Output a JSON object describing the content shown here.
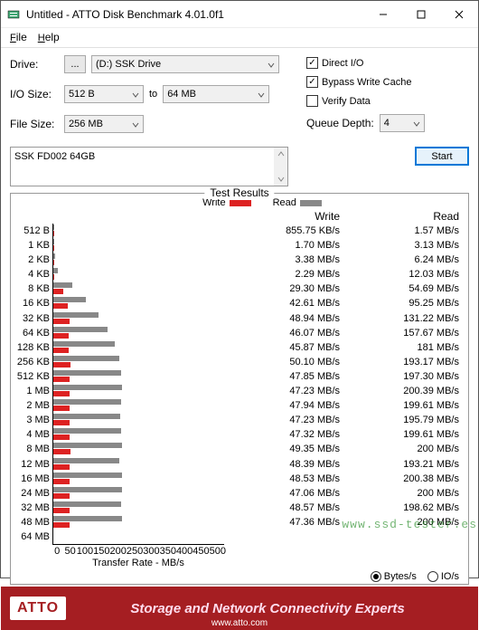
{
  "window": {
    "title": "Untitled - ATTO Disk Benchmark 4.01.0f1"
  },
  "menu": {
    "file": "File",
    "help": "Help"
  },
  "labels": {
    "drive": "Drive:",
    "iosize": "I/O Size:",
    "filesize": "File Size:",
    "to": "to",
    "direct_io": "Direct I/O",
    "bypass": "Bypass Write Cache",
    "verify": "Verify Data",
    "queue": "Queue Depth:",
    "start": "Start",
    "results": "Test Results",
    "write": "Write",
    "read": "Read",
    "xlabel": "Transfer Rate - MB/s",
    "bytes_s": "Bytes/s",
    "io_s": "IO/s",
    "brand": "ATTO",
    "tagline": "Storage and Network Connectivity Experts",
    "site": "www.atto.com"
  },
  "fields": {
    "drive": "(D:) SSK Drive",
    "io_from": "512 B",
    "io_to": "64 MB",
    "filesize": "256 MB",
    "queue": "4",
    "desc": "SSK FD002 64GB"
  },
  "watermark": "www.ssd-tester.es",
  "xticks": [
    "0",
    "50",
    "100",
    "150",
    "200",
    "250",
    "300",
    "350",
    "400",
    "450",
    "500"
  ],
  "chart_data": {
    "type": "bar",
    "xlabel": "Transfer Rate - MB/s",
    "xlim": [
      0,
      500
    ],
    "categories": [
      "512 B",
      "1 KB",
      "2 KB",
      "4 KB",
      "8 KB",
      "16 KB",
      "32 KB",
      "64 KB",
      "128 KB",
      "256 KB",
      "512 KB",
      "1 MB",
      "2 MB",
      "3 MB",
      "4 MB",
      "8 MB",
      "12 MB",
      "16 MB",
      "24 MB",
      "32 MB",
      "48 MB",
      "64 MB"
    ],
    "series": [
      {
        "name": "Write",
        "color": "#d22",
        "values_label": [
          "855.75 KB/s",
          "1.70 MB/s",
          "3.38 MB/s",
          "2.29 MB/s",
          "29.30 MB/s",
          "42.61 MB/s",
          "48.94 MB/s",
          "46.07 MB/s",
          "45.87 MB/s",
          "50.10 MB/s",
          "47.85 MB/s",
          "47.23 MB/s",
          "47.94 MB/s",
          "47.23 MB/s",
          "47.32 MB/s",
          "49.35 MB/s",
          "48.39 MB/s",
          "48.53 MB/s",
          "47.06 MB/s",
          "48.57 MB/s",
          "47.36 MB/s"
        ],
        "values_mb": [
          0.836,
          1.7,
          3.38,
          2.29,
          29.3,
          42.61,
          48.94,
          46.07,
          45.87,
          50.1,
          47.85,
          47.23,
          47.94,
          47.23,
          47.32,
          49.35,
          48.39,
          48.53,
          47.06,
          48.57,
          47.36
        ]
      },
      {
        "name": "Read",
        "color": "#888",
        "values_label": [
          "1.57 MB/s",
          "3.13 MB/s",
          "6.24 MB/s",
          "12.03 MB/s",
          "54.69 MB/s",
          "95.25 MB/s",
          "131.22 MB/s",
          "157.67 MB/s",
          "181 MB/s",
          "193.17 MB/s",
          "197.30 MB/s",
          "200.39 MB/s",
          "199.61 MB/s",
          "195.79 MB/s",
          "199.61 MB/s",
          "200 MB/s",
          "193.21 MB/s",
          "200.38 MB/s",
          "200 MB/s",
          "198.62 MB/s",
          "200 MB/s"
        ],
        "values_mb": [
          1.57,
          3.13,
          6.24,
          12.03,
          54.69,
          95.25,
          131.22,
          157.67,
          181,
          193.17,
          197.3,
          200.39,
          199.61,
          195.79,
          199.61,
          200,
          193.21,
          200.38,
          200,
          198.62,
          200
        ]
      }
    ]
  }
}
